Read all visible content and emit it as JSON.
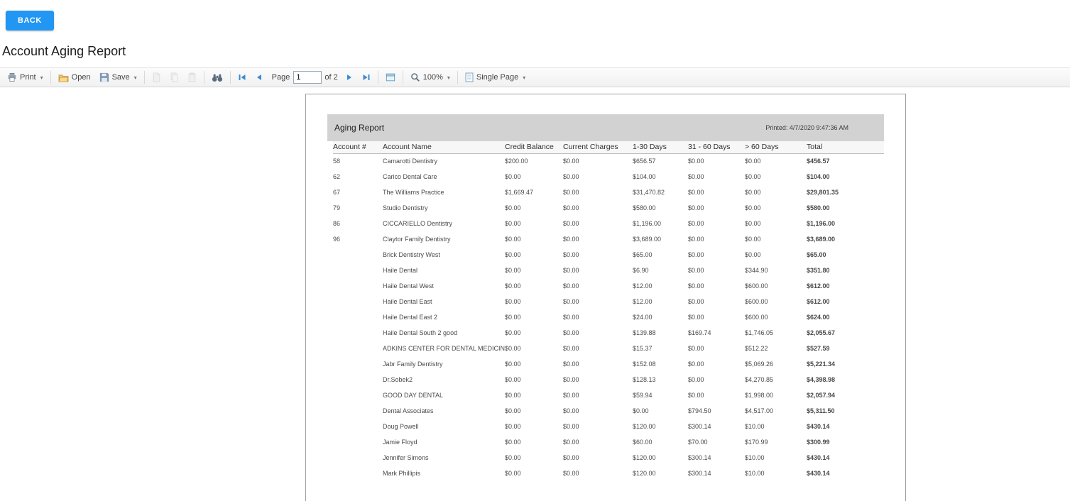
{
  "back_button": "BACK",
  "page_title": "Account Aging Report",
  "toolbar": {
    "print": "Print",
    "open": "Open",
    "save": "Save",
    "page_label": "Page",
    "page_value": "1",
    "page_of": "of 2",
    "zoom": "100%",
    "page_layout": "Single Page"
  },
  "icons": {
    "printer": "printer-icon",
    "folder": "open-folder-icon",
    "floppy": "save-disk-icon",
    "export1": "export-document-icon",
    "export2": "copy-document-icon",
    "export3": "paste-document-icon",
    "binoculars": "search-binoculars-icon",
    "first": "first-page-icon",
    "prev": "previous-page-icon",
    "next": "next-page-icon",
    "last": "last-page-icon",
    "parameters": "parameters-panel-icon",
    "magnifier": "zoom-magnifier-icon",
    "page": "single-page-layout-icon"
  },
  "colors": {
    "accent_blue": "#2196f3",
    "nav_arrow": "#3d8ad1",
    "band_gray": "#d2d2d2"
  },
  "report": {
    "title": "Aging Report",
    "printed": "Printed: 4/7/2020 9:47:36 AM",
    "columns": [
      "Account #",
      "Account Name",
      "Credit Balance",
      "Current Charges",
      "1-30 Days",
      "31 - 60 Days",
      "> 60 Days",
      "Total"
    ],
    "rows": [
      [
        "58",
        "Camarotti Dentistry",
        "$200.00",
        "$0.00",
        "$656.57",
        "$0.00",
        "$0.00",
        "$456.57"
      ],
      [
        "62",
        "Carico Dental Care",
        "$0.00",
        "$0.00",
        "$104.00",
        "$0.00",
        "$0.00",
        "$104.00"
      ],
      [
        "67",
        "The Williams Practice",
        "$1,669.47",
        "$0.00",
        "$31,470.82",
        "$0.00",
        "$0.00",
        "$29,801.35"
      ],
      [
        "79",
        "Studio Dentistry",
        "$0.00",
        "$0.00",
        "$580.00",
        "$0.00",
        "$0.00",
        "$580.00"
      ],
      [
        "86",
        "CICCARIELLO Dentistry",
        "$0.00",
        "$0.00",
        "$1,196.00",
        "$0.00",
        "$0.00",
        "$1,196.00"
      ],
      [
        "96",
        "Claytor Family Dentistry",
        "$0.00",
        "$0.00",
        "$3,689.00",
        "$0.00",
        "$0.00",
        "$3,689.00"
      ],
      [
        "",
        "Brick Dentistry West",
        "$0.00",
        "$0.00",
        "$65.00",
        "$0.00",
        "$0.00",
        "$65.00"
      ],
      [
        "",
        "Haile Dental",
        "$0.00",
        "$0.00",
        "$6.90",
        "$0.00",
        "$344.90",
        "$351.80"
      ],
      [
        "",
        "Haile Dental West",
        "$0.00",
        "$0.00",
        "$12.00",
        "$0.00",
        "$600.00",
        "$612.00"
      ],
      [
        "",
        "Haile Dental East",
        "$0.00",
        "$0.00",
        "$12.00",
        "$0.00",
        "$600.00",
        "$612.00"
      ],
      [
        "",
        "Haile Dental East 2",
        "$0.00",
        "$0.00",
        "$24.00",
        "$0.00",
        "$600.00",
        "$624.00"
      ],
      [
        "",
        "Haile Dental South 2 good",
        "$0.00",
        "$0.00",
        "$139.88",
        "$169.74",
        "$1,746.05",
        "$2,055.67"
      ],
      [
        "",
        "ADKINS CENTER FOR DENTAL MEDICINE",
        "$0.00",
        "$0.00",
        "$15.37",
        "$0.00",
        "$512.22",
        "$527.59"
      ],
      [
        "",
        "Jabr Family Dentistry",
        "$0.00",
        "$0.00",
        "$152.08",
        "$0.00",
        "$5,069.26",
        "$5,221.34"
      ],
      [
        "",
        "Dr.Sobek2",
        "$0.00",
        "$0.00",
        "$128.13",
        "$0.00",
        "$4,270.85",
        "$4,398.98"
      ],
      [
        "",
        "GOOD DAY DENTAL",
        "$0.00",
        "$0.00",
        "$59.94",
        "$0.00",
        "$1,998.00",
        "$2,057.94"
      ],
      [
        "",
        "Dental Associates",
        "$0.00",
        "$0.00",
        "$0.00",
        "$794.50",
        "$4,517.00",
        "$5,311.50"
      ],
      [
        "",
        "Doug Powell",
        "$0.00",
        "$0.00",
        "$120.00",
        "$300.14",
        "$10.00",
        "$430.14"
      ],
      [
        "",
        "Jamie Floyd",
        "$0.00",
        "$0.00",
        "$60.00",
        "$70.00",
        "$170.99",
        "$300.99"
      ],
      [
        "",
        "Jennifer Simons",
        "$0.00",
        "$0.00",
        "$120.00",
        "$300.14",
        "$10.00",
        "$430.14"
      ],
      [
        "",
        "Mark Phillipis",
        "$0.00",
        "$0.00",
        "$120.00",
        "$300.14",
        "$10.00",
        "$430.14"
      ]
    ]
  }
}
